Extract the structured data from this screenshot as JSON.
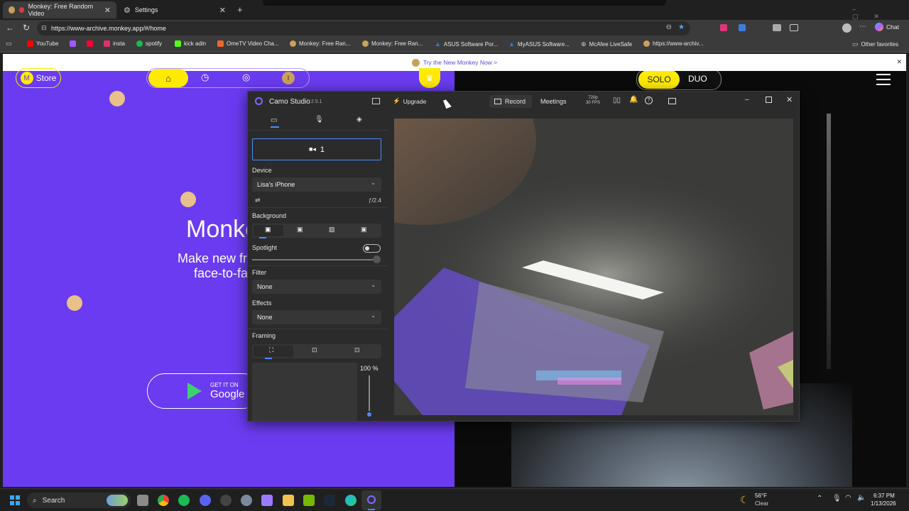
{
  "browser": {
    "tabs": [
      {
        "label": "Monkey: Free Random Video",
        "active": true
      },
      {
        "label": "Settings",
        "active": false
      }
    ],
    "url": "https://www-archive.monkey.app/#/home",
    "bookmarks": [
      {
        "label": "YouTube",
        "color": "#ff0000"
      },
      {
        "label": "",
        "color": "#a259ff"
      },
      {
        "label": "",
        "color": "#ff0033"
      },
      {
        "label": "insta",
        "color": "#e1306c"
      },
      {
        "label": "spotify",
        "color": "#1db954"
      },
      {
        "label": "kick adin",
        "color": "#53fc18"
      },
      {
        "label": "OmeTV Video Cha...",
        "color": "#e86a2b"
      },
      {
        "label": "Monkey: Free Ran...",
        "color": "#c9a15a"
      },
      {
        "label": "Monkey: Free Ran...",
        "color": "#c9a15a"
      },
      {
        "label": "ASUS Software Por...",
        "color": "#2a7bde"
      },
      {
        "label": "MyASUS Software...",
        "color": "#2a7bde"
      },
      {
        "label": "McAfee LiveSafe",
        "color": "#c01818"
      },
      {
        "label": "https://www-archiv...",
        "color": "#c9a15a"
      }
    ],
    "other_favorites": "Other favorites",
    "chat_label": "Chat",
    "infobar_text": "Try the New Monkey Now >"
  },
  "site": {
    "store_label": "Store",
    "store_initial": "M",
    "user_initial": "I",
    "heading": "Monke",
    "subtext_line1": "Make new fr",
    "subtext_line2": "face-to-fa",
    "google_get": "GET IT ON",
    "google_name": "Google",
    "solo_label": "SOLO",
    "duo_label": "DUO",
    "accent": "#ffea00",
    "background": "#6a3bf0"
  },
  "camo": {
    "app_name": "Camo Studio",
    "version": "2.5.1",
    "upgrade_label": "Upgrade",
    "record_label": "Record",
    "meetings_label": "Meetings",
    "res_line1": "720p",
    "res_line2": "30 FPS",
    "camera_slot": "1",
    "device_heading": "Device",
    "device_value": "Lisa's iPhone",
    "aperture": "ƒ/2.4",
    "background_heading": "Background",
    "spotlight_label": "Spotlight",
    "filter_heading": "Filter",
    "filter_value": "None",
    "effects_heading": "Effects",
    "effects_value": "None",
    "framing_heading": "Framing",
    "zoom_value": "100 %",
    "spotlight_level": 1.0,
    "zoom_level": 0.0
  },
  "taskbar": {
    "search_label": "Search",
    "weather_temp": "56°F",
    "weather_desc": "Clear",
    "time": "6:37 PM",
    "date": "1/13/2026"
  }
}
